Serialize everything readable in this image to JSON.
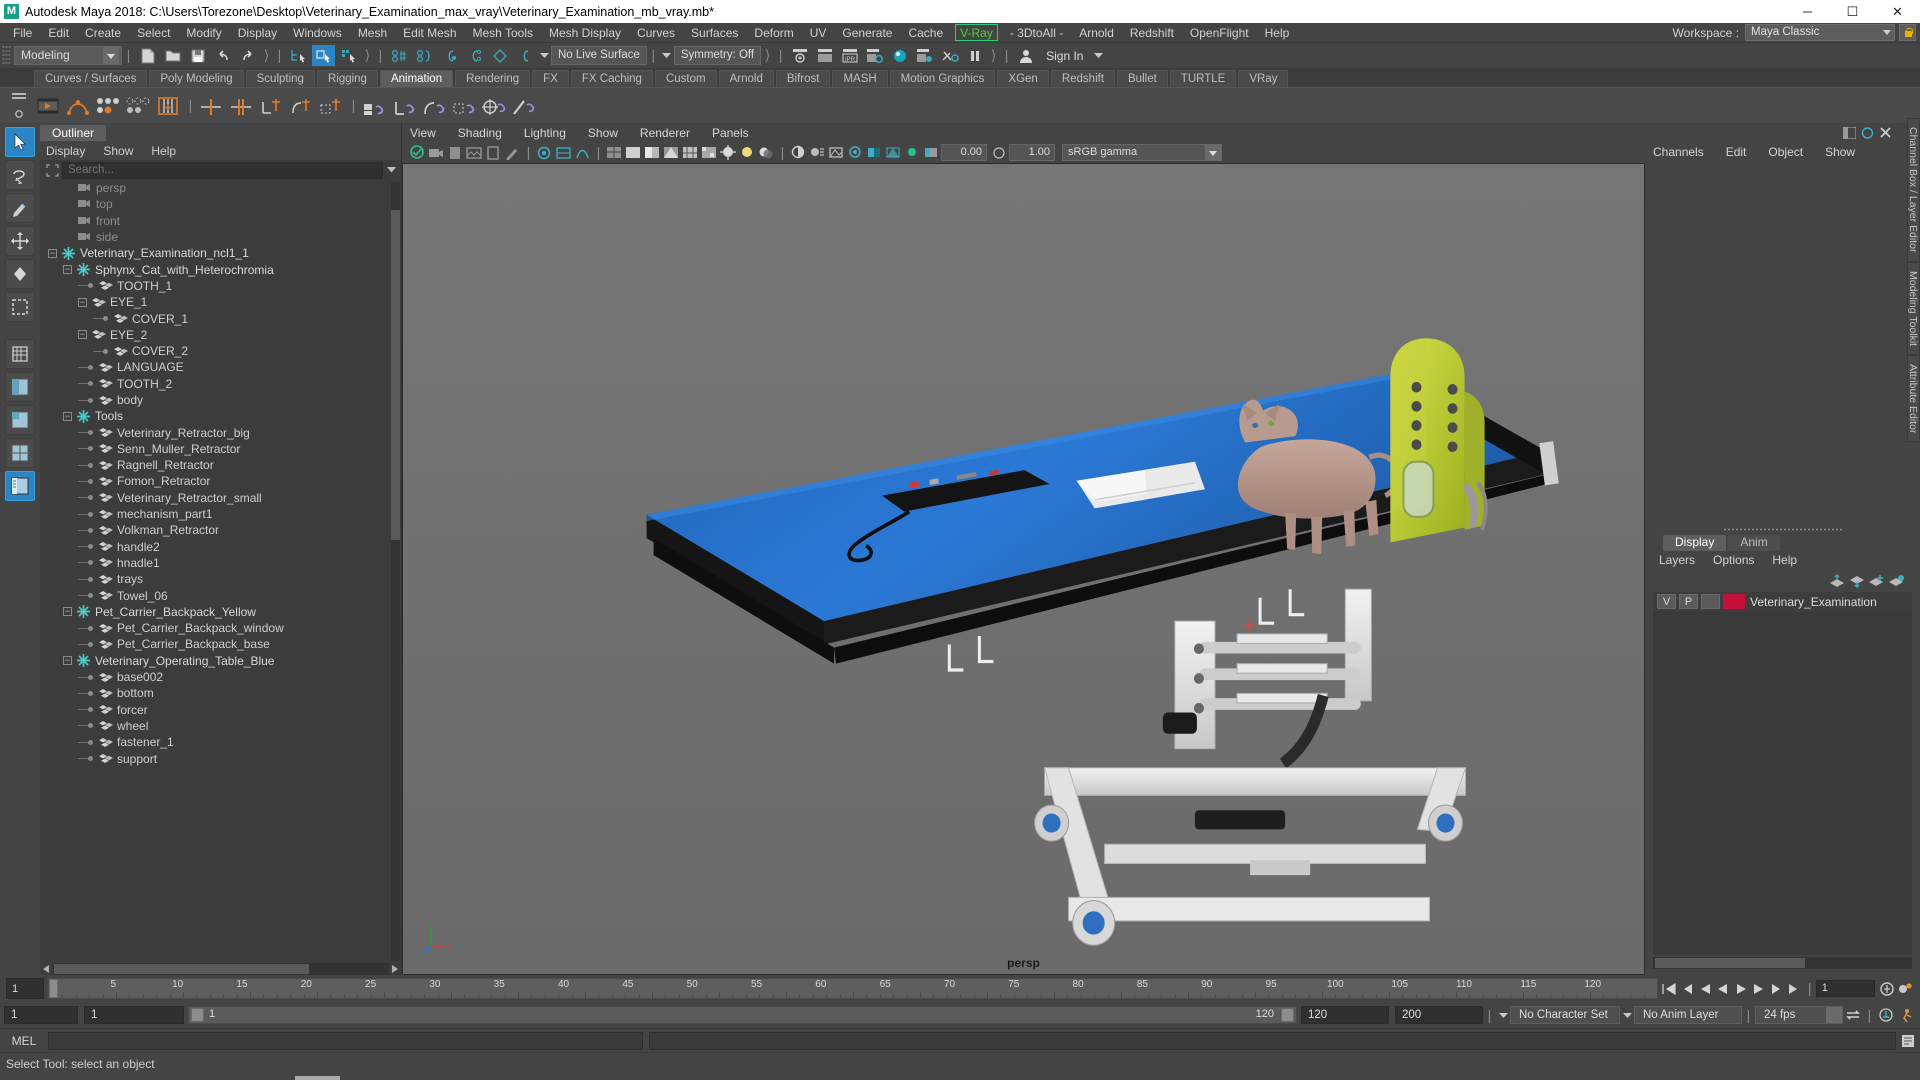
{
  "window": {
    "title": "Autodesk Maya 2018: C:\\Users\\Torezone\\Desktop\\Veterinary_Examination_max_vray\\Veterinary_Examination_mb_vray.mb*",
    "logo_letter": "M",
    "minimize": "─",
    "maximize": "☐",
    "close": "✕"
  },
  "menubar": {
    "items": [
      "File",
      "Edit",
      "Create",
      "Select",
      "Modify",
      "Display",
      "Windows",
      "Mesh",
      "Edit Mesh",
      "Mesh Tools",
      "Mesh Display",
      "Curves",
      "Surfaces",
      "Deform",
      "UV",
      "Generate",
      "Cache",
      "V-Ray",
      "- 3DtoAll -",
      "Arnold",
      "Redshift",
      "OpenFlight",
      "Help"
    ],
    "vray_item": "V-Ray",
    "workspace_label": "Workspace :",
    "workspace_value": "Maya Classic"
  },
  "statusbar": {
    "mode": "Modeling",
    "live_surface": "No Live Surface",
    "symmetry": "Symmetry: Off",
    "signin": "Sign In"
  },
  "shelf": {
    "tabs": [
      "Curves / Surfaces",
      "Poly Modeling",
      "Sculpting",
      "Rigging",
      "Animation",
      "Rendering",
      "FX",
      "FX Caching",
      "Custom",
      "Arnold",
      "Bifrost",
      "MASH",
      "Motion Graphics",
      "XGen",
      "Redshift",
      "Bullet",
      "TURTLE",
      "VRay"
    ],
    "active_tab": "Animation"
  },
  "outliner": {
    "tab": "Outliner",
    "menu": [
      "Display",
      "Show",
      "Help"
    ],
    "search_placeholder": "Search...",
    "items": [
      {
        "label": "persp",
        "depth": 1,
        "icon": "camera-icon",
        "kind": "camera",
        "expander": "none",
        "dim": true
      },
      {
        "label": "top",
        "depth": 1,
        "icon": "camera-icon",
        "kind": "camera",
        "expander": "none",
        "dim": true
      },
      {
        "label": "front",
        "depth": 1,
        "icon": "camera-icon",
        "kind": "camera",
        "expander": "none",
        "dim": true
      },
      {
        "label": "side",
        "depth": 1,
        "icon": "camera-icon",
        "kind": "camera",
        "expander": "none",
        "dim": true
      },
      {
        "label": "Veterinary_Examination_ncl1_1",
        "depth": 0,
        "icon": "group-star-icon",
        "kind": "group",
        "expander": "minus",
        "dim": false
      },
      {
        "label": "Sphynx_Cat_with_Heterochromia",
        "depth": 1,
        "icon": "group-star-icon",
        "kind": "group",
        "expander": "minus",
        "dim": false
      },
      {
        "label": "TOOTH_1",
        "depth": 2,
        "icon": "mesh-icon",
        "kind": "mesh",
        "expander": "dot",
        "dim": false
      },
      {
        "label": "EYE_1",
        "depth": 2,
        "icon": "mesh-icon",
        "kind": "mesh",
        "expander": "minus",
        "dim": false
      },
      {
        "label": "COVER_1",
        "depth": 3,
        "icon": "mesh-icon",
        "kind": "mesh",
        "expander": "dot",
        "dim": false
      },
      {
        "label": "EYE_2",
        "depth": 2,
        "icon": "mesh-icon",
        "kind": "mesh",
        "expander": "minus",
        "dim": false
      },
      {
        "label": "COVER_2",
        "depth": 3,
        "icon": "mesh-icon",
        "kind": "mesh",
        "expander": "dot",
        "dim": false
      },
      {
        "label": "LANGUAGE",
        "depth": 2,
        "icon": "mesh-icon",
        "kind": "mesh",
        "expander": "dot",
        "dim": false
      },
      {
        "label": "TOOTH_2",
        "depth": 2,
        "icon": "mesh-icon",
        "kind": "mesh",
        "expander": "dot",
        "dim": false
      },
      {
        "label": "body",
        "depth": 2,
        "icon": "mesh-icon",
        "kind": "mesh",
        "expander": "dot",
        "dim": false
      },
      {
        "label": "Tools",
        "depth": 1,
        "icon": "group-star-icon",
        "kind": "group",
        "expander": "minus",
        "dim": false
      },
      {
        "label": "Veterinary_Retractor_big",
        "depth": 2,
        "icon": "mesh-icon",
        "kind": "mesh",
        "expander": "dot",
        "dim": false
      },
      {
        "label": "Senn_Muller_Retractor",
        "depth": 2,
        "icon": "mesh-icon",
        "kind": "mesh",
        "expander": "dot",
        "dim": false
      },
      {
        "label": "Ragnell_Retractor",
        "depth": 2,
        "icon": "mesh-icon",
        "kind": "mesh",
        "expander": "dot",
        "dim": false
      },
      {
        "label": "Fomon_Retractor",
        "depth": 2,
        "icon": "mesh-icon",
        "kind": "mesh",
        "expander": "dot",
        "dim": false
      },
      {
        "label": "Veterinary_Retractor_small",
        "depth": 2,
        "icon": "mesh-icon",
        "kind": "mesh",
        "expander": "dot",
        "dim": false
      },
      {
        "label": "mechanism_part1",
        "depth": 2,
        "icon": "mesh-icon",
        "kind": "mesh",
        "expander": "dot",
        "dim": false
      },
      {
        "label": "Volkman_Retractor",
        "depth": 2,
        "icon": "mesh-icon",
        "kind": "mesh",
        "expander": "dot",
        "dim": false
      },
      {
        "label": "handle2",
        "depth": 2,
        "icon": "mesh-icon",
        "kind": "mesh",
        "expander": "dot",
        "dim": false
      },
      {
        "label": "hnadle1",
        "depth": 2,
        "icon": "mesh-icon",
        "kind": "mesh",
        "expander": "dot",
        "dim": false
      },
      {
        "label": "trays",
        "depth": 2,
        "icon": "mesh-icon",
        "kind": "mesh",
        "expander": "dot",
        "dim": false
      },
      {
        "label": "Towel_06",
        "depth": 2,
        "icon": "mesh-icon",
        "kind": "mesh",
        "expander": "dot",
        "dim": false
      },
      {
        "label": "Pet_Carrier_Backpack_Yellow",
        "depth": 1,
        "icon": "group-star-icon",
        "kind": "group",
        "expander": "minus",
        "dim": false
      },
      {
        "label": "Pet_Carrier_Backpack_window",
        "depth": 2,
        "icon": "mesh-icon",
        "kind": "mesh",
        "expander": "dot",
        "dim": false
      },
      {
        "label": "Pet_Carrier_Backpack_base",
        "depth": 2,
        "icon": "mesh-icon",
        "kind": "mesh",
        "expander": "dot",
        "dim": false
      },
      {
        "label": "Veterinary_Operating_Table_Blue",
        "depth": 1,
        "icon": "group-star-icon",
        "kind": "group",
        "expander": "minus",
        "dim": false
      },
      {
        "label": "base002",
        "depth": 2,
        "icon": "mesh-icon",
        "kind": "mesh",
        "expander": "dot",
        "dim": false
      },
      {
        "label": "bottom",
        "depth": 2,
        "icon": "mesh-icon",
        "kind": "mesh",
        "expander": "dot",
        "dim": false
      },
      {
        "label": "forcer",
        "depth": 2,
        "icon": "mesh-icon",
        "kind": "mesh",
        "expander": "dot",
        "dim": false
      },
      {
        "label": "wheel",
        "depth": 2,
        "icon": "mesh-icon",
        "kind": "mesh",
        "expander": "dot",
        "dim": false
      },
      {
        "label": "fastener_1",
        "depth": 2,
        "icon": "mesh-icon",
        "kind": "mesh",
        "expander": "dot",
        "dim": false
      },
      {
        "label": "support",
        "depth": 2,
        "icon": "mesh-icon",
        "kind": "mesh",
        "expander": "dot",
        "dim": false
      }
    ]
  },
  "viewport": {
    "menu": [
      "View",
      "Shading",
      "Lighting",
      "Show",
      "Renderer",
      "Panels"
    ],
    "exposure": "0.00",
    "gamma": "1.00",
    "color_profile": "sRGB gamma",
    "camera_label": "persp",
    "axis_labels": {
      "x": "x",
      "y": "y",
      "z": "z"
    }
  },
  "channelbox": {
    "menu": [
      "Channels",
      "Edit",
      "Object",
      "Show"
    ]
  },
  "layers": {
    "tabs": [
      "Display",
      "Anim"
    ],
    "active_tab": "Display",
    "menu": [
      "Layers",
      "Options",
      "Help"
    ],
    "rows": [
      {
        "visible": "V",
        "playback": "P",
        "third": "",
        "color": "#c4103a",
        "name": "Veterinary_Examination"
      }
    ]
  },
  "sidetabs": [
    "Channel Box / Layer Editor",
    "Modeling Toolkit",
    "Attribute Editor"
  ],
  "timeline": {
    "current_frame": "1",
    "ticks": [
      "5",
      "10",
      "15",
      "20",
      "25",
      "30",
      "35",
      "40",
      "45",
      "50",
      "55",
      "60",
      "65",
      "70",
      "75",
      "80",
      "85",
      "90",
      "95",
      "100",
      "105",
      "110",
      "115",
      "120"
    ],
    "playback_frame": "1"
  },
  "range": {
    "start": "1",
    "anim_start": "1",
    "slider_start": "1",
    "slider_end": "120",
    "range_end": "120",
    "anim_end": "200",
    "character_set": "No Character Set",
    "anim_layer": "No Anim Layer",
    "fps": "24 fps"
  },
  "command": {
    "label": "MEL",
    "input_value": ""
  },
  "status": {
    "help_text": "Select Tool: select an object"
  }
}
